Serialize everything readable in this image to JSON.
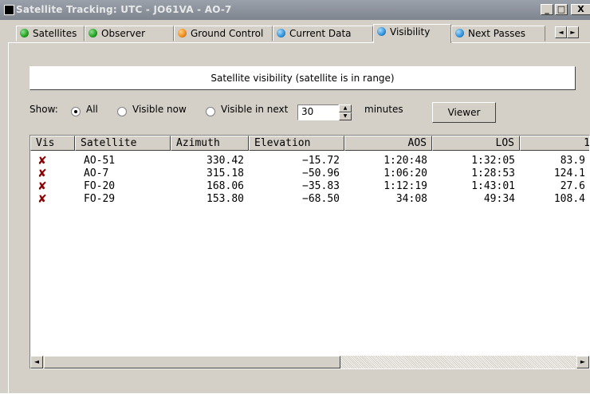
{
  "window": {
    "title": "Satellite Tracking: UTC - JO61VA - AO-7",
    "minimize_glyph": "_",
    "maximize_glyph": "□",
    "close_glyph": "X"
  },
  "tabs": [
    {
      "label": "Satellites",
      "icon": "green-globe-icon",
      "color": "#1fa11f"
    },
    {
      "label": "Observer",
      "icon": "green-globe-icon",
      "color": "#1fa11f"
    },
    {
      "label": "Ground Control",
      "icon": "orange-globe-icon",
      "color": "#f08a1c"
    },
    {
      "label": "Current Data",
      "icon": "blue-globe-icon",
      "color": "#2e8fd8"
    },
    {
      "label": "Visibility",
      "icon": "blue-globe-icon",
      "color": "#2e8fd8",
      "active": true
    },
    {
      "label": "Next Passes",
      "icon": "blue-globe-icon",
      "color": "#2e8fd8"
    }
  ],
  "tab_nav": {
    "left": "◄",
    "right": "►"
  },
  "banner": "Satellite visibility (satellite is in range)",
  "show": {
    "label": "Show:",
    "options": [
      "All",
      "Visible now",
      "Visible in next"
    ],
    "selected": "All",
    "minutes_value": "30",
    "minutes_label": "minutes",
    "spin_up": "▲",
    "spin_down": "▼"
  },
  "viewer_button": "Viewer",
  "table": {
    "columns": [
      "Vis",
      "Satellite",
      "Azimuth",
      "Elevation",
      "AOS",
      "LOS",
      "1"
    ],
    "rows": [
      {
        "vis": "✘",
        "satellite": "AO-51",
        "azimuth": "330.42",
        "elevation": "−15.72",
        "aos": "1:20:48",
        "los": "1:32:05",
        "extra": "83.9"
      },
      {
        "vis": "✘",
        "satellite": "AO-7",
        "azimuth": "315.18",
        "elevation": "−50.96",
        "aos": "1:06:20",
        "los": "1:28:53",
        "extra": "124.1"
      },
      {
        "vis": "✘",
        "satellite": "FO-20",
        "azimuth": "168.06",
        "elevation": "−35.83",
        "aos": "1:12:19",
        "los": "1:43:01",
        "extra": "27.6"
      },
      {
        "vis": "✘",
        "satellite": "FO-29",
        "azimuth": "153.80",
        "elevation": "−68.50",
        "aos": "34:08",
        "los": "49:34",
        "extra": "108.4"
      }
    ]
  },
  "scrollbar": {
    "left": "◄",
    "right": "►"
  },
  "colors": {
    "vis_mark": "#8b0000",
    "titlebar": "#8a919b"
  }
}
